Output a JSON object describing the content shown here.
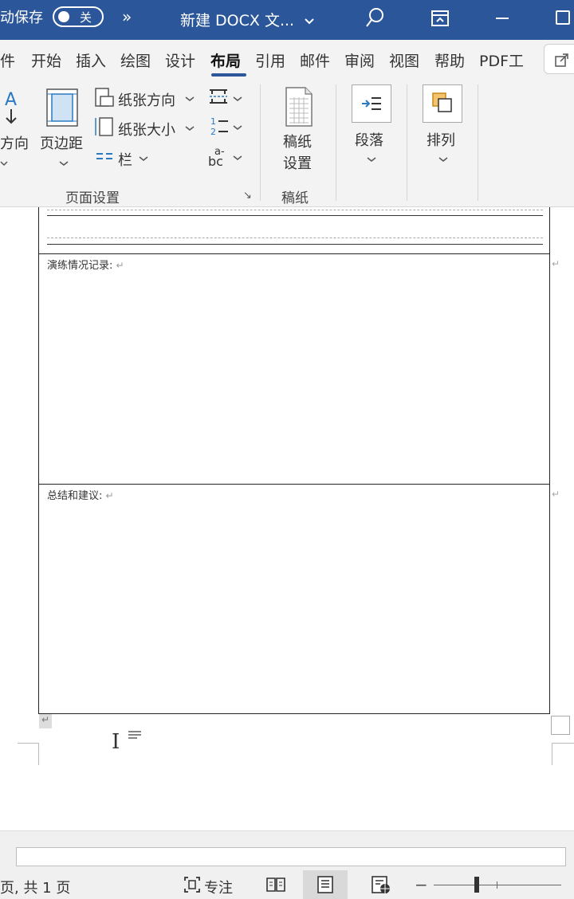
{
  "titlebar": {
    "autosave_label": "动保存",
    "toggle_state": "关",
    "more": "»",
    "doc_title": "新建 DOCX 文...",
    "chevron": "⌄"
  },
  "tabs": [
    "件",
    "开始",
    "插入",
    "绘图",
    "设计",
    "布局",
    "引用",
    "邮件",
    "审阅",
    "视图",
    "帮助",
    "PDF工"
  ],
  "active_tab": "布局",
  "ribbon": {
    "direction_label": "方向",
    "margins_label": "页边距",
    "orientation_label": "纸张方向",
    "size_label": "纸张大小",
    "columns_label": "栏",
    "page_setup_group": "页面设置",
    "draft_paper_btn_line1": "稿纸",
    "draft_paper_btn_line2": "设置",
    "draft_paper_group": "稿纸",
    "paragraph_label": "段落",
    "arrange_label": "排列",
    "dialog_launcher": "↘"
  },
  "document": {
    "drill_record_label": "演练情况记录:",
    "summary_label": "总结和建议:",
    "return_mark": "↵"
  },
  "statusbar": {
    "page_info": "页, 共 1 页",
    "focus_label": "专注",
    "zoom_minus": "−"
  }
}
